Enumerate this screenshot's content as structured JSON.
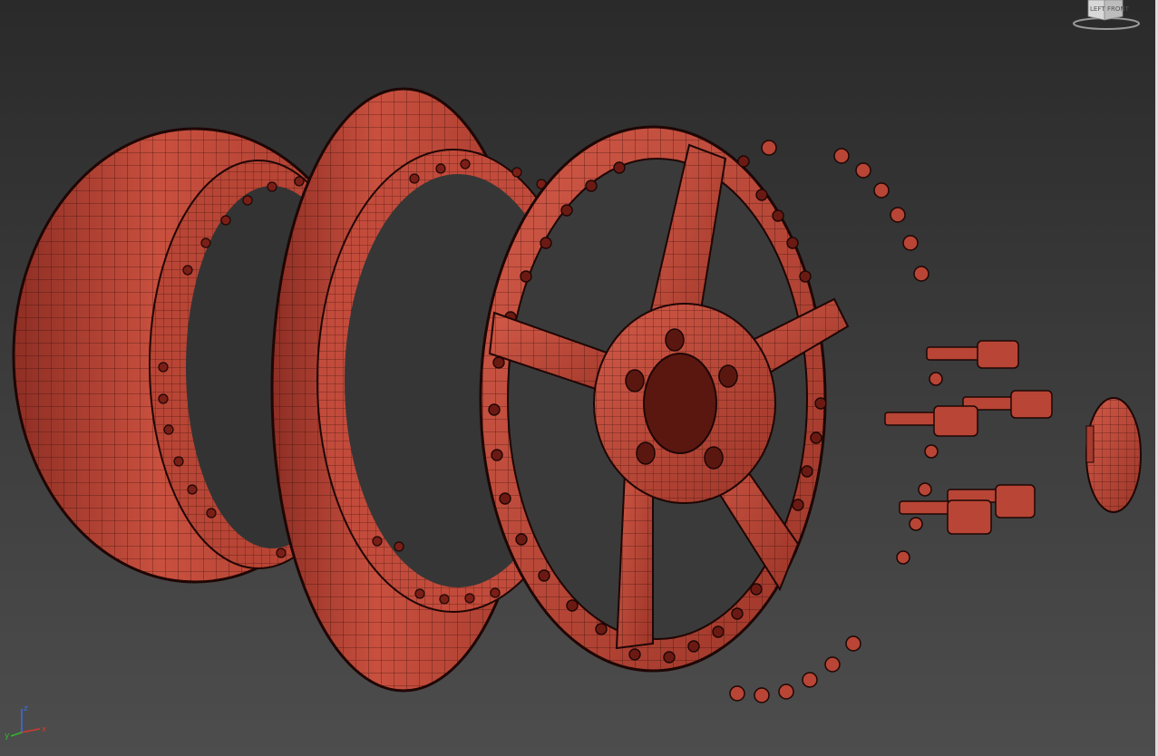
{
  "viewport": {
    "background_top": "#2a2a2a",
    "background_bottom": "#4d4d4d",
    "model_color": "#c0493a",
    "wire_color": "#2a0a06"
  },
  "viewcube": {
    "left_label": "LEFT",
    "front_label": "FRONT"
  },
  "axis": {
    "x_label": "x",
    "y_label": "y",
    "z_label": "z",
    "x_color": "#d33a2c",
    "y_color": "#2fb82f",
    "z_color": "#3a6fe0"
  }
}
